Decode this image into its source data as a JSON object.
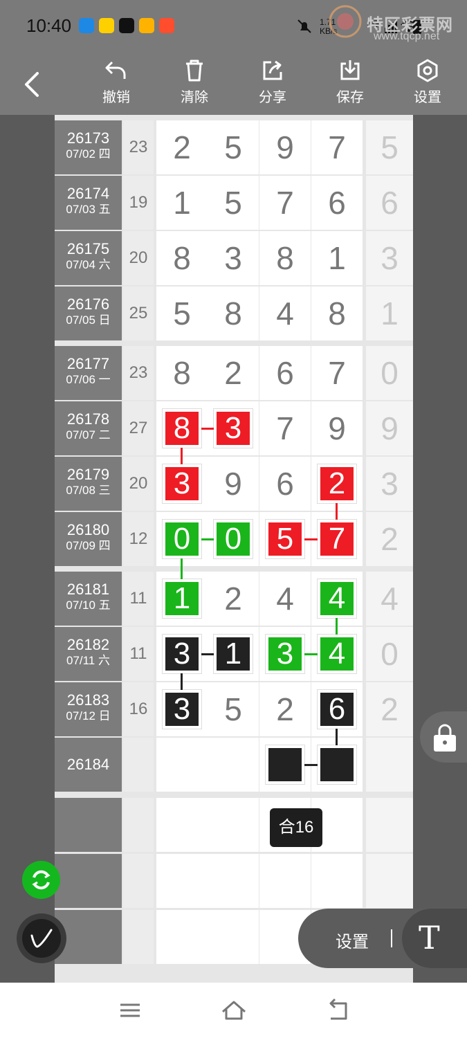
{
  "status": {
    "time": "10:40",
    "speed": "1.71\nKB/s",
    "network": "5G"
  },
  "watermark": {
    "title": "特区彩票网",
    "url": "www.tqcp.net"
  },
  "toolbar": {
    "undo_label": "撤销",
    "clear_label": "清除",
    "share_label": "分享",
    "save_label": "保存",
    "settings_label": "设置"
  },
  "rows": [
    {
      "issue": "26173",
      "date": "07/02 四",
      "sum": "23",
      "digits": [
        "2",
        "5",
        "9",
        "7"
      ],
      "last": "5"
    },
    {
      "issue": "26174",
      "date": "07/03 五",
      "sum": "19",
      "digits": [
        "1",
        "5",
        "7",
        "6"
      ],
      "last": "6"
    },
    {
      "issue": "26175",
      "date": "07/04 六",
      "sum": "20",
      "digits": [
        "8",
        "3",
        "8",
        "1"
      ],
      "last": "3"
    },
    {
      "issue": "26176",
      "date": "07/05 日",
      "sum": "25",
      "digits": [
        "5",
        "8",
        "4",
        "8"
      ],
      "last": "1"
    },
    {
      "issue": "26177",
      "date": "07/06 一",
      "sum": "23",
      "digits": [
        "8",
        "2",
        "6",
        "7"
      ],
      "last": "0"
    },
    {
      "issue": "26178",
      "date": "07/07 二",
      "sum": "27",
      "digits": [
        "8",
        "3",
        "7",
        "9"
      ],
      "last": "9"
    },
    {
      "issue": "26179",
      "date": "07/08 三",
      "sum": "20",
      "digits": [
        "3",
        "9",
        "6",
        "2"
      ],
      "last": "3"
    },
    {
      "issue": "26180",
      "date": "07/09 四",
      "sum": "12",
      "digits": [
        "0",
        "0",
        "5",
        "7"
      ],
      "last": "2"
    },
    {
      "issue": "26181",
      "date": "07/10 五",
      "sum": "11",
      "digits": [
        "1",
        "2",
        "4",
        "4"
      ],
      "last": "4"
    },
    {
      "issue": "26182",
      "date": "07/11 六",
      "sum": "11",
      "digits": [
        "3",
        "1",
        "3",
        "4"
      ],
      "last": "0"
    },
    {
      "issue": "26183",
      "date": "07/12 日",
      "sum": "16",
      "digits": [
        "3",
        "5",
        "2",
        "6"
      ],
      "last": "2"
    },
    {
      "issue": "26184",
      "date": "",
      "sum": "",
      "digits": [
        "",
        "",
        "",
        ""
      ],
      "last": ""
    }
  ],
  "sum_badge": "合16",
  "bottom_pill": {
    "label": "设置",
    "t_icon": "T"
  },
  "colors": {
    "red": "#ee1c25",
    "green": "#1ab51a",
    "black": "#222222",
    "refresh": "#14b81e"
  }
}
